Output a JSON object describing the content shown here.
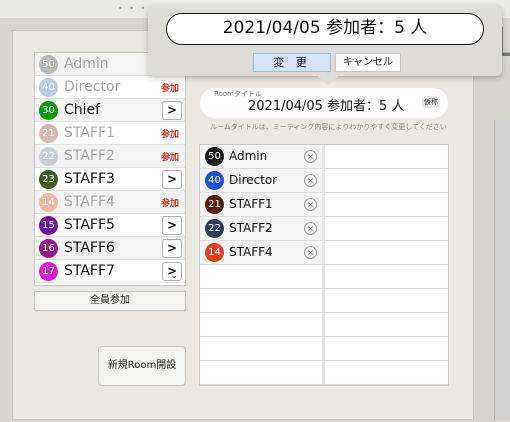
{
  "popover": {
    "title_value": "2021/04/05 参加者：5 人",
    "change_label": "変 更",
    "cancel_label": "キャンセル"
  },
  "members": [
    {
      "num": "50",
      "name": "Admin",
      "color": "#b9b9b9",
      "dim": true,
      "action": "none"
    },
    {
      "num": "40",
      "name": "Director",
      "color": "#b9cbe6",
      "dim": true,
      "action": "参加"
    },
    {
      "num": "30",
      "name": "Chief",
      "color": "#0a9a0a",
      "dim": false,
      "action": "arrow"
    },
    {
      "num": "21",
      "name": "STAFF1",
      "color": "#d8b9b0",
      "dim": true,
      "action": "参加"
    },
    {
      "num": "22",
      "name": "STAFF2",
      "color": "#c9cdd8",
      "dim": true,
      "action": "参加"
    },
    {
      "num": "23",
      "name": "STAFF3",
      "color": "#3f5a23",
      "dim": false,
      "action": "arrow"
    },
    {
      "num": "14",
      "name": "STAFF4",
      "color": "#f3b9a3",
      "dim": true,
      "action": "参加"
    },
    {
      "num": "15",
      "name": "STAFF5",
      "color": "#6f0fa8",
      "dim": false,
      "action": "arrow"
    },
    {
      "num": "16",
      "name": "STAFF6",
      "color": "#8f1f8f",
      "dim": false,
      "action": "arrow"
    },
    {
      "num": "17",
      "name": "STAFF7",
      "color": "#d81fd8",
      "dim": false,
      "action": "arrow"
    }
  ],
  "arrow_glyph": ">",
  "list_scroll_glyph": "⌄",
  "all_join_label": "全員参加",
  "new_room_label": "新規Room開設",
  "room_title": {
    "caption": "Roomタイトル",
    "value": "2021/04/05 参加者：5 人",
    "badge": "仮称"
  },
  "hint": "ルームタイトルは、ミーティング内容によりわかりやすく変更してください",
  "participants": [
    {
      "num": "50",
      "name": "Admin",
      "color": "#1e1e1e"
    },
    {
      "num": "40",
      "name": "Director",
      "color": "#1f4fd6"
    },
    {
      "num": "21",
      "name": "STAFF1",
      "color": "#5a1a0c"
    },
    {
      "num": "22",
      "name": "STAFF2",
      "color": "#2d3e5f"
    },
    {
      "num": "14",
      "name": "STAFF4",
      "color": "#e2401a"
    }
  ],
  "remove_glyph": "×"
}
